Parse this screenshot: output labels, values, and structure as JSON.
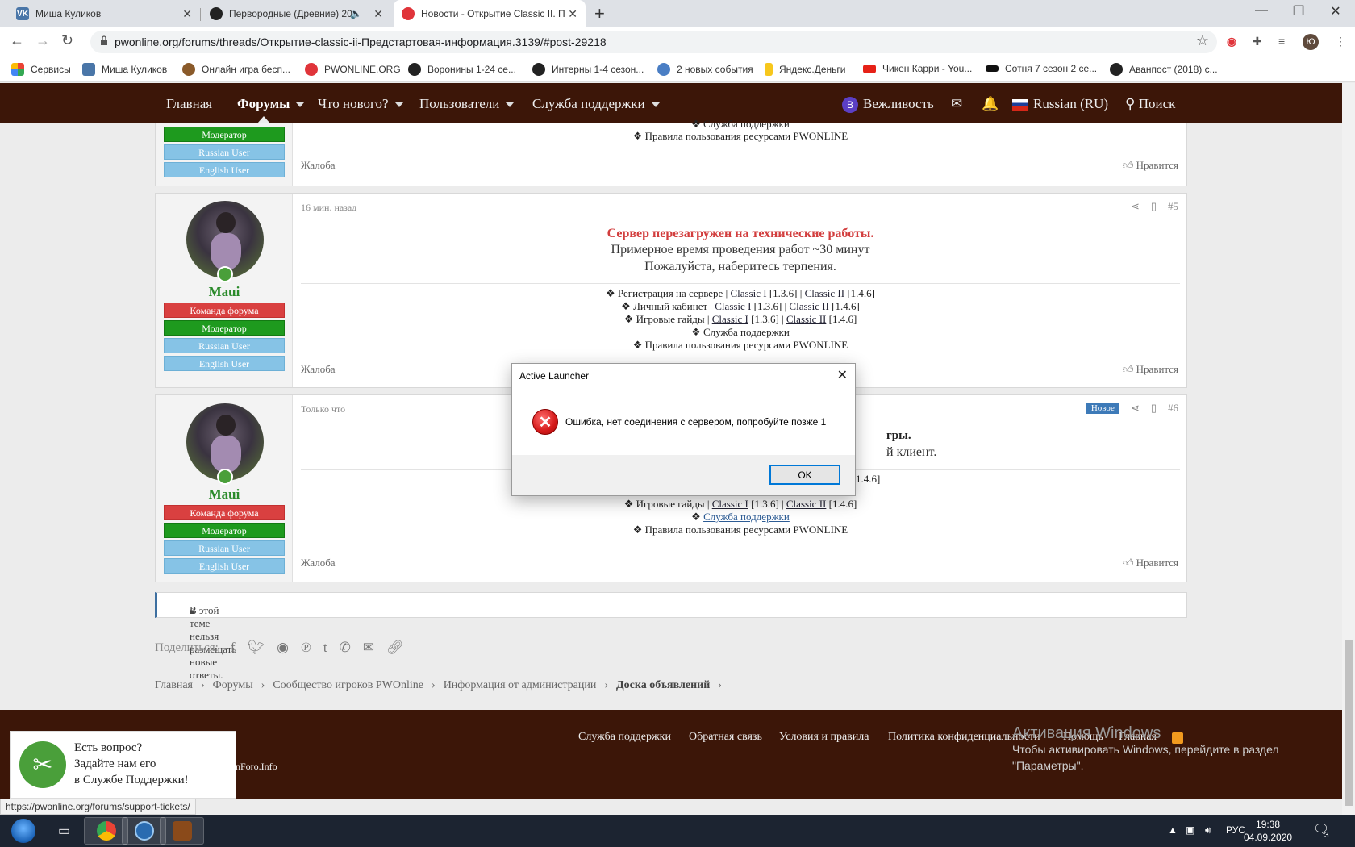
{
  "browser": {
    "tabs": [
      {
        "title": "Миша Куликов"
      },
      {
        "title": "Первородные (Древние) 20"
      },
      {
        "title": "Новости - Открытие Classic II. П"
      }
    ],
    "url": "pwonline.org/forums/threads/Открытие-classic-ii-Предстартовая-информация.3139/#post-29218",
    "profile_initial": "Ю",
    "bookmarks": [
      "Сервисы",
      "Миша Куликов",
      "Онлайн игра бесп...",
      "PWONLINE.ORG",
      "Воронины 1-24 се...",
      "Интерны 1-4 сезон...",
      "2 новых события",
      "Яндекс.Деньги",
      "Чикен Карри - You...",
      "Сотня 7 сезон 2 се...",
      "Аванпост (2018) с..."
    ]
  },
  "nav": {
    "home": "Главная",
    "forums": "Форумы",
    "whats_new": "Что нового?",
    "users": "Пользователи",
    "support": "Служба поддержки",
    "user_initial": "В",
    "user_name": "Вежливость",
    "language": "Russian (RU)",
    "search": "Поиск"
  },
  "badges": {
    "team": "Команда форума",
    "moderator": "Модератор",
    "russian": "Russian User",
    "english": "English User"
  },
  "post_prev": {
    "line_support": "❖ Служба поддержки",
    "line_rules": "❖ Правила пользования ресурсами PWONLINE"
  },
  "common": {
    "report": "Жалоба",
    "like": "Нравится"
  },
  "post5": {
    "author": "Maui",
    "time": "16 мин. назад",
    "num": "#5",
    "headline": "Сервер перезагружен на технические работы.",
    "line1": "Примерное время проведения работ ~30 минут",
    "line2": "Пожалуйста, наберитесь терпения.",
    "reg_prefix": "❖ Регистрация на сервере |",
    "cab_prefix": "❖ Личный кабинет |",
    "guides_prefix": "❖ Игровые гайды |",
    "c1": "Classic I",
    "c1v": "[1.3.6] |",
    "c2": "Classic II",
    "c2v": "[1.4.6]",
    "support": "❖ Служба поддержки",
    "rules": "❖ Правила пользования ресурсами PWONLINE"
  },
  "post6": {
    "author": "Maui",
    "time": "Только что",
    "new_badge": "Новое",
    "num": "#6",
    "headline_tail": "гры.",
    "line1_tail": "й клиент.",
    "reg_tail": "1.4.6]",
    "guides_prefix": "❖ Игровые гайды |",
    "c1": "Classic I",
    "c1v": "[1.3.6] |",
    "c2": "Classic II",
    "c2v": "[1.4.6]",
    "support_prefix": "❖",
    "support_link": "Служба поддержки",
    "rules": "❖ Правила пользования ресурсами PWONLINE"
  },
  "locked": "В этой теме нельзя размещать новые ответы.",
  "share_label": "Поделиться:",
  "breadcrumbs": [
    "Главная",
    "Форумы",
    "Сообщество игроков PWOnline",
    "Информация от администрации",
    "Доска объявлений"
  ],
  "footer": {
    "links": [
      "Служба поддержки",
      "Обратная связь",
      "Условия и правила",
      "Политика конфиденциальности",
      "Помощь",
      "Главная"
    ],
    "xf": "nForo.Info"
  },
  "windows_activation": {
    "title": "Активация Windows",
    "line1": "Чтобы активировать Windows, перейдите в раздел",
    "line2": "\"Параметры\"."
  },
  "support_widget": {
    "l1": "Есть вопрос?",
    "l2": "Задайте нам его",
    "l3": "в Службе Поддержки!"
  },
  "status_url": "https://pwonline.org/forums/support-tickets/",
  "dialog": {
    "title": "Active Launcher",
    "message": "Ошибка, нет соединения с сервером, попробуйте позже 1",
    "ok": "OK"
  },
  "taskbar": {
    "lang": "РУС",
    "time": "19:38",
    "date": "04.09.2020",
    "notif_count": "3"
  }
}
